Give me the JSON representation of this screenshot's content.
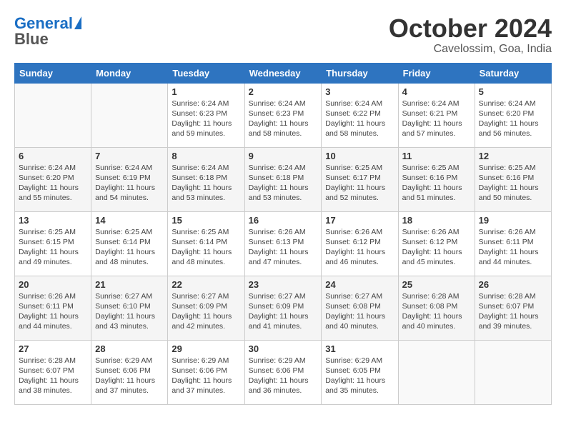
{
  "header": {
    "logo_line1": "General",
    "logo_line2": "Blue",
    "month": "October 2024",
    "location": "Cavelossim, Goa, India"
  },
  "weekdays": [
    "Sunday",
    "Monday",
    "Tuesday",
    "Wednesday",
    "Thursday",
    "Friday",
    "Saturday"
  ],
  "weeks": [
    [
      {
        "day": "",
        "info": ""
      },
      {
        "day": "",
        "info": ""
      },
      {
        "day": "1",
        "sunrise": "6:24 AM",
        "sunset": "6:23 PM",
        "daylight": "11 hours and 59 minutes."
      },
      {
        "day": "2",
        "sunrise": "6:24 AM",
        "sunset": "6:23 PM",
        "daylight": "11 hours and 58 minutes."
      },
      {
        "day": "3",
        "sunrise": "6:24 AM",
        "sunset": "6:22 PM",
        "daylight": "11 hours and 58 minutes."
      },
      {
        "day": "4",
        "sunrise": "6:24 AM",
        "sunset": "6:21 PM",
        "daylight": "11 hours and 57 minutes."
      },
      {
        "day": "5",
        "sunrise": "6:24 AM",
        "sunset": "6:20 PM",
        "daylight": "11 hours and 56 minutes."
      }
    ],
    [
      {
        "day": "6",
        "sunrise": "6:24 AM",
        "sunset": "6:20 PM",
        "daylight": "11 hours and 55 minutes."
      },
      {
        "day": "7",
        "sunrise": "6:24 AM",
        "sunset": "6:19 PM",
        "daylight": "11 hours and 54 minutes."
      },
      {
        "day": "8",
        "sunrise": "6:24 AM",
        "sunset": "6:18 PM",
        "daylight": "11 hours and 53 minutes."
      },
      {
        "day": "9",
        "sunrise": "6:24 AM",
        "sunset": "6:18 PM",
        "daylight": "11 hours and 53 minutes."
      },
      {
        "day": "10",
        "sunrise": "6:25 AM",
        "sunset": "6:17 PM",
        "daylight": "11 hours and 52 minutes."
      },
      {
        "day": "11",
        "sunrise": "6:25 AM",
        "sunset": "6:16 PM",
        "daylight": "11 hours and 51 minutes."
      },
      {
        "day": "12",
        "sunrise": "6:25 AM",
        "sunset": "6:16 PM",
        "daylight": "11 hours and 50 minutes."
      }
    ],
    [
      {
        "day": "13",
        "sunrise": "6:25 AM",
        "sunset": "6:15 PM",
        "daylight": "11 hours and 49 minutes."
      },
      {
        "day": "14",
        "sunrise": "6:25 AM",
        "sunset": "6:14 PM",
        "daylight": "11 hours and 48 minutes."
      },
      {
        "day": "15",
        "sunrise": "6:25 AM",
        "sunset": "6:14 PM",
        "daylight": "11 hours and 48 minutes."
      },
      {
        "day": "16",
        "sunrise": "6:26 AM",
        "sunset": "6:13 PM",
        "daylight": "11 hours and 47 minutes."
      },
      {
        "day": "17",
        "sunrise": "6:26 AM",
        "sunset": "6:12 PM",
        "daylight": "11 hours and 46 minutes."
      },
      {
        "day": "18",
        "sunrise": "6:26 AM",
        "sunset": "6:12 PM",
        "daylight": "11 hours and 45 minutes."
      },
      {
        "day": "19",
        "sunrise": "6:26 AM",
        "sunset": "6:11 PM",
        "daylight": "11 hours and 44 minutes."
      }
    ],
    [
      {
        "day": "20",
        "sunrise": "6:26 AM",
        "sunset": "6:11 PM",
        "daylight": "11 hours and 44 minutes."
      },
      {
        "day": "21",
        "sunrise": "6:27 AM",
        "sunset": "6:10 PM",
        "daylight": "11 hours and 43 minutes."
      },
      {
        "day": "22",
        "sunrise": "6:27 AM",
        "sunset": "6:09 PM",
        "daylight": "11 hours and 42 minutes."
      },
      {
        "day": "23",
        "sunrise": "6:27 AM",
        "sunset": "6:09 PM",
        "daylight": "11 hours and 41 minutes."
      },
      {
        "day": "24",
        "sunrise": "6:27 AM",
        "sunset": "6:08 PM",
        "daylight": "11 hours and 40 minutes."
      },
      {
        "day": "25",
        "sunrise": "6:28 AM",
        "sunset": "6:08 PM",
        "daylight": "11 hours and 40 minutes."
      },
      {
        "day": "26",
        "sunrise": "6:28 AM",
        "sunset": "6:07 PM",
        "daylight": "11 hours and 39 minutes."
      }
    ],
    [
      {
        "day": "27",
        "sunrise": "6:28 AM",
        "sunset": "6:07 PM",
        "daylight": "11 hours and 38 minutes."
      },
      {
        "day": "28",
        "sunrise": "6:29 AM",
        "sunset": "6:06 PM",
        "daylight": "11 hours and 37 minutes."
      },
      {
        "day": "29",
        "sunrise": "6:29 AM",
        "sunset": "6:06 PM",
        "daylight": "11 hours and 37 minutes."
      },
      {
        "day": "30",
        "sunrise": "6:29 AM",
        "sunset": "6:06 PM",
        "daylight": "11 hours and 36 minutes."
      },
      {
        "day": "31",
        "sunrise": "6:29 AM",
        "sunset": "6:05 PM",
        "daylight": "11 hours and 35 minutes."
      },
      {
        "day": "",
        "info": ""
      },
      {
        "day": "",
        "info": ""
      }
    ]
  ]
}
